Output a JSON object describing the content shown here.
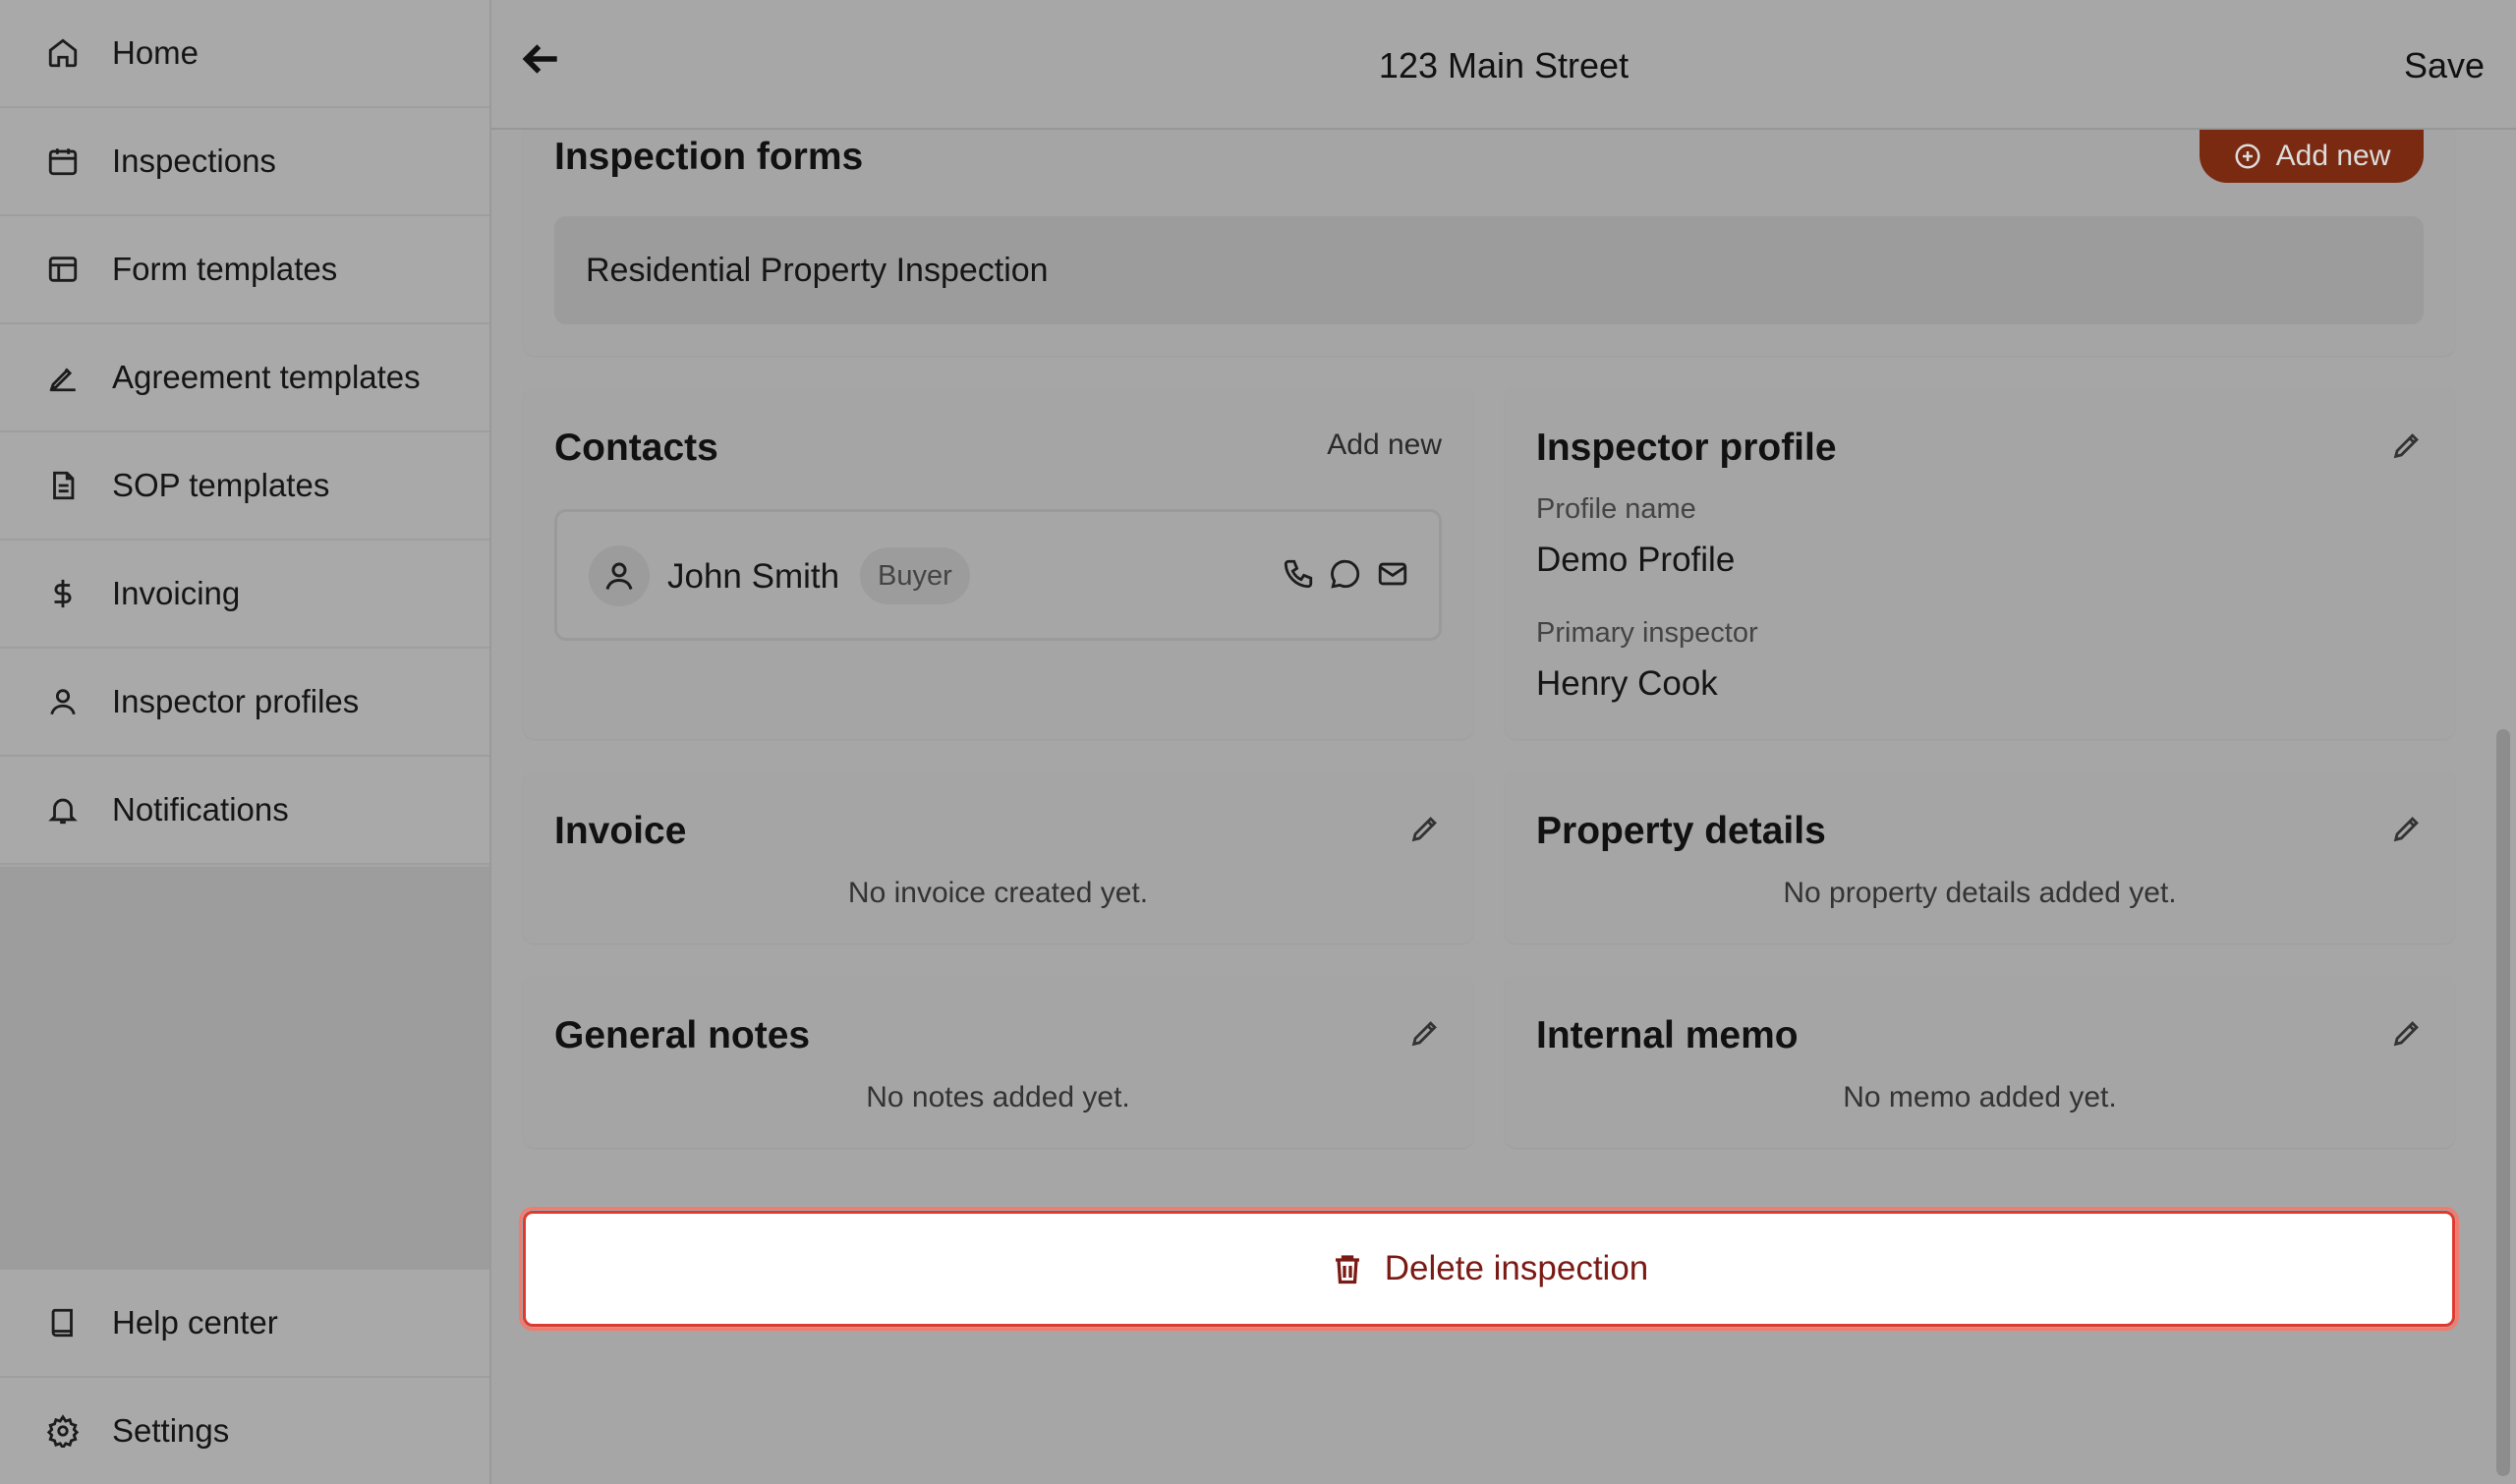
{
  "sidebar": {
    "items": [
      {
        "label": "Home",
        "icon": "home-icon"
      },
      {
        "label": "Inspections",
        "icon": "calendar-icon"
      },
      {
        "label": "Form templates",
        "icon": "layout-icon"
      },
      {
        "label": "Agreement templates",
        "icon": "signature-icon"
      },
      {
        "label": "SOP templates",
        "icon": "document-icon"
      },
      {
        "label": "Invoicing",
        "icon": "dollar-icon"
      },
      {
        "label": "Inspector profiles",
        "icon": "user-icon"
      },
      {
        "label": "Notifications",
        "icon": "bell-icon"
      }
    ],
    "bottom_items": [
      {
        "label": "Help center",
        "icon": "book-icon"
      },
      {
        "label": "Settings",
        "icon": "gear-icon"
      }
    ]
  },
  "header": {
    "title": "123 Main Street",
    "save_label": "Save"
  },
  "inspection_forms": {
    "title": "Inspection forms",
    "add_label": "Add new",
    "items": [
      "Residential Property Inspection"
    ]
  },
  "contacts": {
    "title": "Contacts",
    "add_label": "Add new",
    "items": [
      {
        "name": "John Smith",
        "role": "Buyer"
      }
    ]
  },
  "inspector_profile": {
    "title": "Inspector profile",
    "profile_name_label": "Profile name",
    "profile_name": "Demo Profile",
    "primary_inspector_label": "Primary inspector",
    "primary_inspector": "Henry Cook"
  },
  "invoice": {
    "title": "Invoice",
    "empty": "No invoice created yet."
  },
  "property_details": {
    "title": "Property details",
    "empty": "No property details added yet."
  },
  "general_notes": {
    "title": "General notes",
    "empty": "No notes added yet."
  },
  "internal_memo": {
    "title": "Internal memo",
    "empty": "No memo added yet."
  },
  "delete_label": "Delete inspection",
  "colors": {
    "accent": "#7a2a10",
    "danger_border": "#e03a2e",
    "danger_text": "#7a1a14"
  }
}
